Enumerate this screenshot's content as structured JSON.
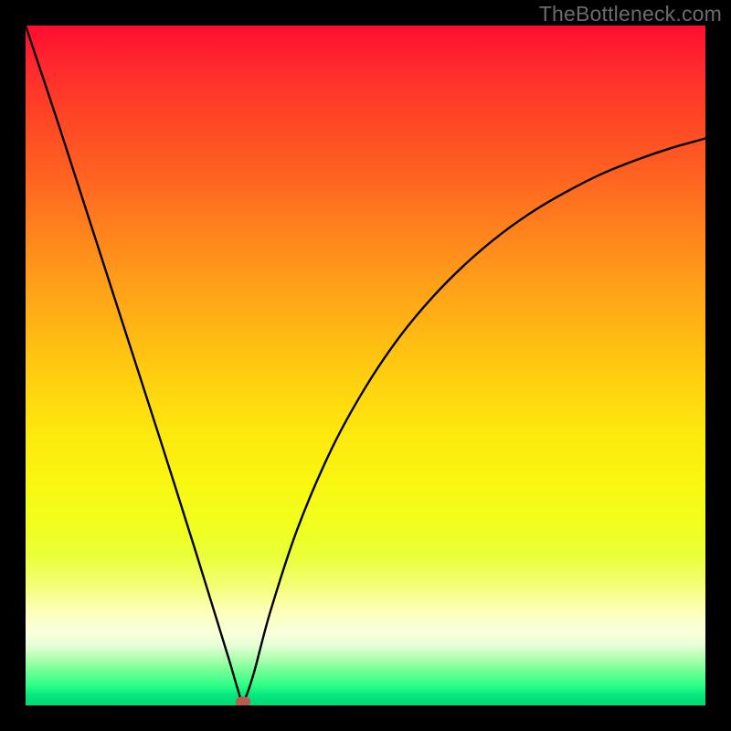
{
  "watermark": "TheBottleneck.com",
  "colors": {
    "frame": "#000000",
    "curve": "#000000",
    "marker": "#bb5a4e"
  },
  "chart_data": {
    "type": "line",
    "title": "",
    "xlabel": "",
    "ylabel": "",
    "xlim": [
      0,
      100
    ],
    "ylim": [
      0,
      100
    ],
    "grid": false,
    "legend": false,
    "series": [
      {
        "name": "bottleneck-curve",
        "x": [
          0,
          5,
          10,
          15,
          20,
          25,
          28,
          30,
          31.3,
          32,
          33.5,
          36,
          40,
          45,
          50,
          55,
          60,
          65,
          70,
          75,
          80,
          85,
          90,
          95,
          100
        ],
        "y": [
          100,
          85,
          69.5,
          54,
          38.5,
          22.7,
          13,
          6.5,
          2.1,
          0.5,
          4.5,
          13.8,
          26,
          37.7,
          46.8,
          54.2,
          60.2,
          65.2,
          69.4,
          72.9,
          75.8,
          78.3,
          80.3,
          82,
          83.4
        ]
      }
    ],
    "marker": {
      "x": 32,
      "y": 0.5
    },
    "gradient_stops": [
      {
        "pos": 0.0,
        "color": "#ff0c30"
      },
      {
        "pos": 0.2,
        "color": "#ff5b22"
      },
      {
        "pos": 0.4,
        "color": "#ffb414"
      },
      {
        "pos": 0.6,
        "color": "#fde80e"
      },
      {
        "pos": 0.8,
        "color": "#f0ff20"
      },
      {
        "pos": 0.9,
        "color": "#e9ffd8"
      },
      {
        "pos": 1.0,
        "color": "#04d877"
      }
    ]
  }
}
